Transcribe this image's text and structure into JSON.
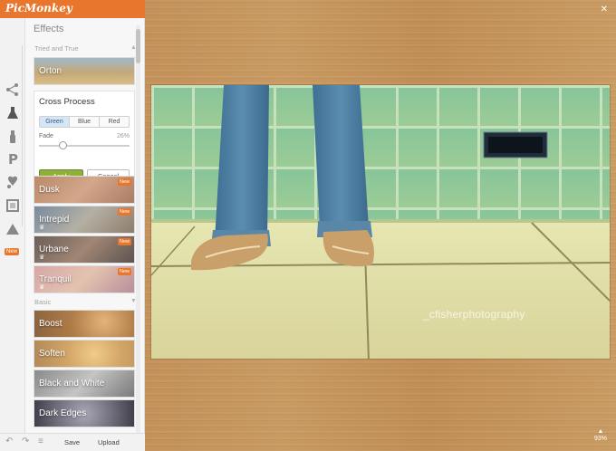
{
  "app": {
    "brand": "PicMonkey"
  },
  "panel": {
    "title": "Effects",
    "sections": {
      "tried_and_true": "Tried and True",
      "basic": "Basic"
    },
    "effects_top": [
      {
        "label": "Orton"
      }
    ],
    "cross_process": {
      "title": "Cross Process",
      "options": [
        "Green",
        "Blue",
        "Red"
      ],
      "selected": "Green",
      "fade_label": "Fade",
      "fade_value": "26%",
      "fade_fraction": 0.26,
      "apply_label": "Apply",
      "cancel_label": "Cancel"
    },
    "effects_new": [
      {
        "label": "Dusk",
        "badge": "New"
      },
      {
        "label": "Intrepid",
        "badge": "New"
      },
      {
        "label": "Urbane",
        "badge": "New"
      },
      {
        "label": "Tranquil",
        "badge": "New"
      }
    ],
    "effects_basic": [
      {
        "label": "Boost"
      },
      {
        "label": "Soften"
      },
      {
        "label": "Black and White"
      },
      {
        "label": "Dark Edges"
      }
    ]
  },
  "sidebar": {
    "tools": [
      "basic-edits-icon",
      "effects-icon",
      "touch-up-icon",
      "text-icon",
      "overlays-icon",
      "frames-icon",
      "textures-icon"
    ],
    "new_badge": "New"
  },
  "bottombar": {
    "save_label": "Save",
    "upload_label": "Upload"
  },
  "workspace": {
    "zoom": "93%",
    "watermark": "_cfisherphotography"
  },
  "colors": {
    "brand": "#e8762c",
    "apply": "#8eaf3a",
    "selected_seg": "#d7e6f5"
  }
}
